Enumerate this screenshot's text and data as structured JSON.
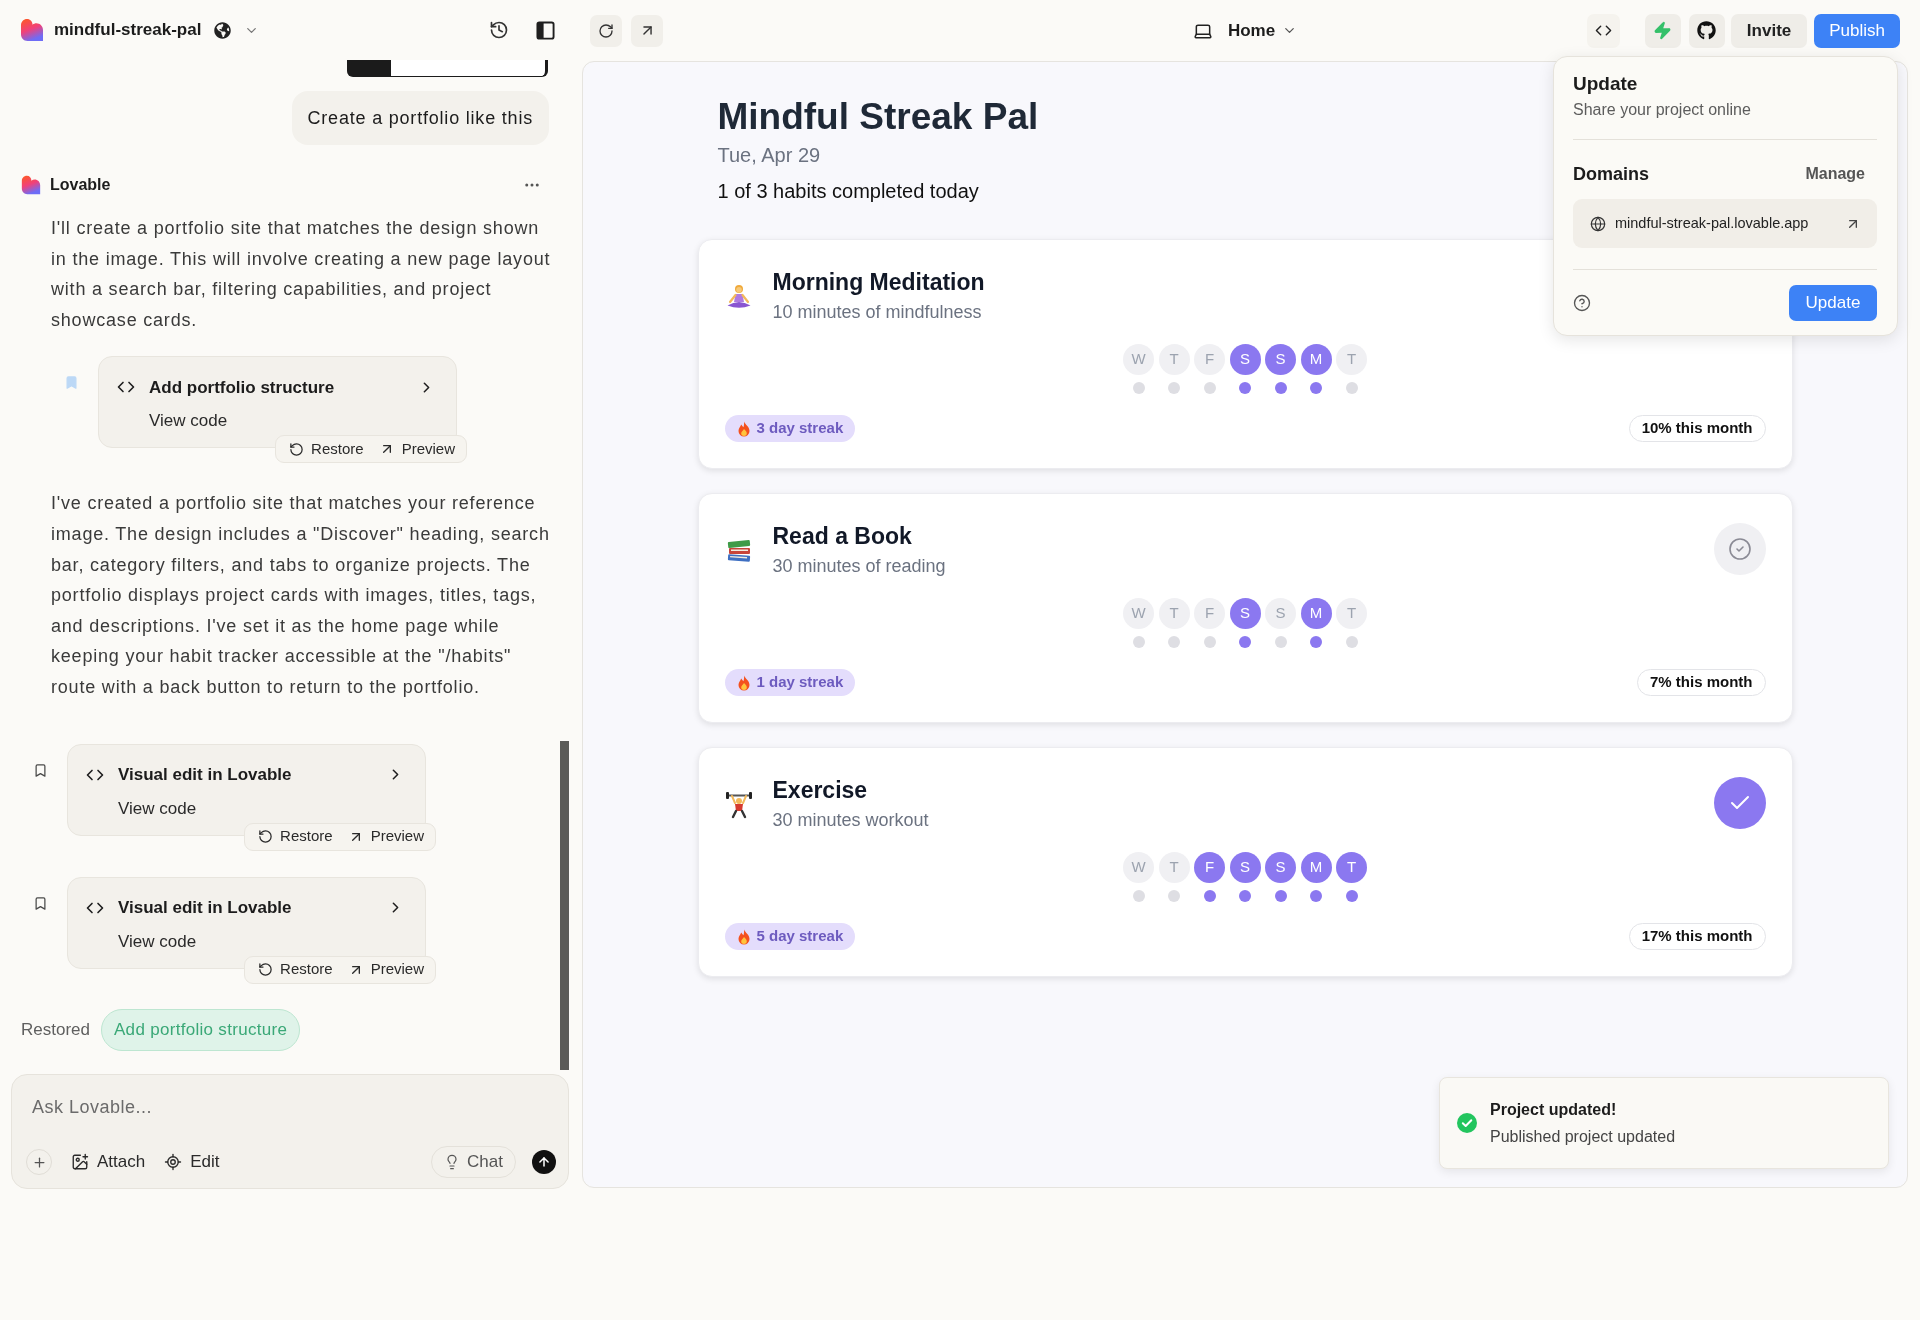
{
  "header": {
    "project_name": "mindful-streak-pal"
  },
  "chat": {
    "messages": [
      {
        "kind": "user",
        "text": "Create a portfolio like this",
        "image_attached": true
      },
      {
        "kind": "assistant",
        "name": "Lovable",
        "blocks": [
          {
            "kind": "text",
            "text": "I'll create a portfolio site that matches the design shown in the image. This will involve creating a new page layout with a search bar, filtering capabilities, and project showcase cards."
          },
          {
            "kind": "version",
            "title": "Add portfolio structure",
            "link": "View code",
            "highlighted": true,
            "actions": [
              "Restore",
              "Preview"
            ]
          },
          {
            "kind": "text",
            "text": "I've created a portfolio site that matches your reference image. The design includes a \"Discover\" heading, search bar, category filters, and tabs to organize projects. The portfolio displays project cards with images, titles, tags, and descriptions. I've set it as the home page while keeping your habit tracker accessible at the \"/habits\" route with a back button to return to the portfolio."
          }
        ]
      },
      {
        "kind": "version",
        "title": "Visual edit in Lovable",
        "link": "View code",
        "highlighted": false,
        "actions": [
          "Restore",
          "Preview"
        ]
      },
      {
        "kind": "version",
        "title": "Visual edit in Lovable",
        "link": "View code",
        "highlighted": false,
        "actions": [
          "Restore",
          "Preview"
        ]
      },
      {
        "kind": "restored",
        "label": "Restored",
        "chip": "Add portfolio structure"
      }
    ]
  },
  "composer": {
    "placeholder": "Ask Lovable...",
    "tools": [
      "Attach",
      "Edit"
    ],
    "mode": "Chat"
  },
  "toolbar": {
    "page": "Home",
    "buttons": [
      "Invite",
      "Publish"
    ]
  },
  "preview": {
    "title": "Mindful Streak Pal",
    "date": "Tue, Apr 29",
    "summary": "1 of 3 habits completed today",
    "habits": [
      {
        "title": "Morning Meditation",
        "subtitle": "10 minutes of mindfulness",
        "days": [
          {
            "label": "W",
            "done": false
          },
          {
            "label": "T",
            "done": false
          },
          {
            "label": "F",
            "done": false
          },
          {
            "label": "S",
            "done": true
          },
          {
            "label": "S",
            "done": true
          },
          {
            "label": "M",
            "done": true
          },
          {
            "label": "T",
            "done": false
          }
        ],
        "streak": "3 day streak",
        "month": "10% this month"
      },
      {
        "title": "Read a Book",
        "subtitle": "30 minutes of reading",
        "completed": false,
        "days": [
          {
            "label": "W",
            "done": false
          },
          {
            "label": "T",
            "done": false
          },
          {
            "label": "F",
            "done": false
          },
          {
            "label": "S",
            "done": true
          },
          {
            "label": "S",
            "done": false
          },
          {
            "label": "M",
            "done": true
          },
          {
            "label": "T",
            "done": false
          }
        ],
        "streak": "1 day streak",
        "month": "7% this month"
      },
      {
        "title": "Exercise",
        "subtitle": "30 minutes workout",
        "completed": true,
        "days": [
          {
            "label": "W",
            "done": false
          },
          {
            "label": "T",
            "done": false
          },
          {
            "label": "F",
            "done": true
          },
          {
            "label": "S",
            "done": true
          },
          {
            "label": "S",
            "done": true
          },
          {
            "label": "M",
            "done": true
          },
          {
            "label": "T",
            "done": true
          }
        ],
        "streak": "5 day streak",
        "month": "17% this month"
      }
    ]
  },
  "publish_popover": {
    "title": "Update",
    "subtitle": "Share your project online",
    "domains_label": "Domains",
    "manage": "Manage",
    "domain": "mindful-streak-pal.lovable.app",
    "button": "Update"
  },
  "toast": {
    "title": "Project updated!",
    "message": "Published project updated"
  }
}
